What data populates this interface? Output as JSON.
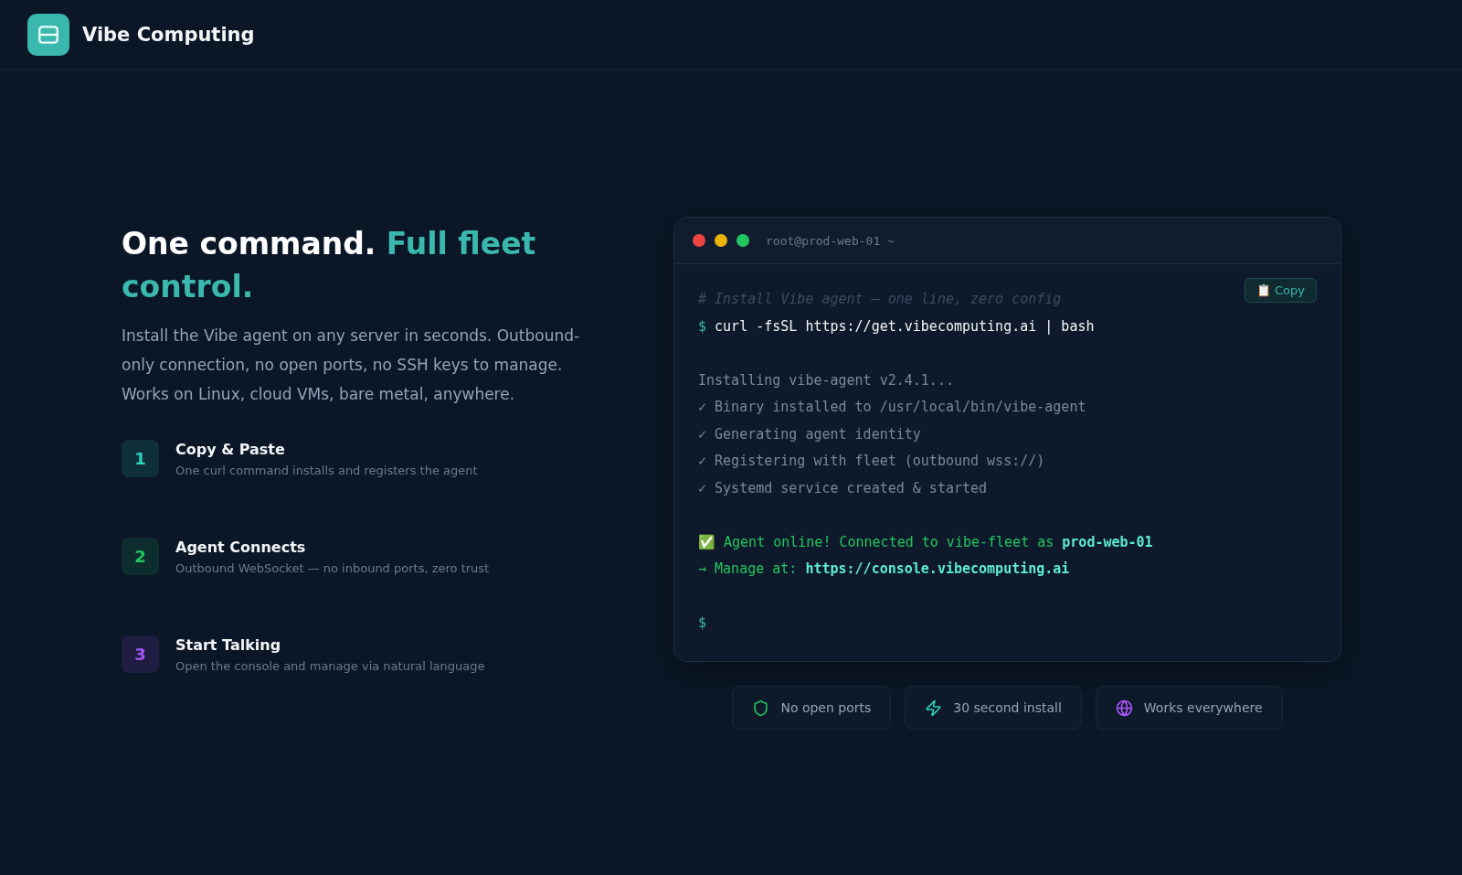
{
  "brand": {
    "name": "Vibe Computing"
  },
  "hero": {
    "title_lead": "One command.",
    "title_accent": "Full fleet control.",
    "description": "Install the Vibe agent on any server in seconds. Outbound-only connection, no open ports, no SSH keys to manage. Works on Linux, cloud VMs, bare metal, anywhere."
  },
  "steps": [
    {
      "number": "1",
      "title": "Copy & Paste",
      "subtitle": "One curl command installs and registers the agent",
      "color": "#2dd4bf"
    },
    {
      "number": "2",
      "title": "Agent Connects",
      "subtitle": "Outbound WebSocket — no inbound ports, zero trust",
      "color": "#22c55e"
    },
    {
      "number": "3",
      "title": "Start Talking",
      "subtitle": "Open the console and manage via natural language",
      "color": "#a855f7"
    }
  ],
  "terminal": {
    "title": "root@prod-web-01 ~",
    "copy_button": "📋 Copy",
    "lines": [
      {
        "kind": "comment",
        "text": "# Install Vibe agent — one line, zero config"
      },
      {
        "kind": "command",
        "prompt": "$",
        "text": "curl -fsSL https://get.vibecomputing.ai | bash"
      },
      {
        "kind": "blank"
      },
      {
        "kind": "output",
        "text": "Installing vibe-agent v2.4.1..."
      },
      {
        "kind": "check",
        "mark": "✓",
        "text": "Binary installed to /usr/local/bin/vibe-agent"
      },
      {
        "kind": "check",
        "mark": "✓",
        "text": "Generating agent identity"
      },
      {
        "kind": "check",
        "mark": "✓",
        "text": "Registering with fleet (outbound wss://)"
      },
      {
        "kind": "check",
        "mark": "✓",
        "text": "Systemd service created & started"
      },
      {
        "kind": "blank"
      },
      {
        "kind": "success",
        "text": "✅ Agent online! Connected to vibe-fleet as",
        "highlight": "prod-web-01"
      },
      {
        "kind": "link",
        "text": "→ Manage at:",
        "highlight": "https://console.vibecomputing.ai"
      },
      {
        "kind": "blank"
      },
      {
        "kind": "prompt",
        "prompt": "$"
      }
    ]
  },
  "features": [
    {
      "kind": "shield",
      "label": "No open ports",
      "color": "#22c55e"
    },
    {
      "kind": "bolt",
      "label": "30 second install",
      "color": "#2dd4bf"
    },
    {
      "kind": "globe",
      "label": "Works everywhere",
      "color": "#a855f7"
    }
  ]
}
